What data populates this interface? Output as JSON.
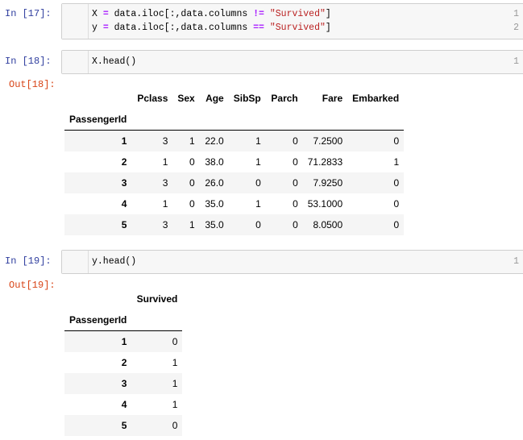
{
  "cells": [
    {
      "prompt": "In [17]:",
      "lines": [
        {
          "num": "1",
          "a": "X ",
          "op": "!=",
          "pre": " data.iloc[:,data.columns ",
          "str": "\"Survived\"",
          "post": "]"
        },
        {
          "num": "2",
          "a": "y ",
          "op": "==",
          "pre": " data.iloc[:,data.columns ",
          "str": "\"Survived\"",
          "post": "]"
        }
      ]
    },
    {
      "prompt": "In [18]:",
      "line": {
        "num": "1",
        "code": "X.head()"
      },
      "out": "Out[18]:"
    },
    {
      "prompt": "In [19]:",
      "line": {
        "num": "1",
        "code": "y.head()"
      },
      "out": "Out[19]:"
    }
  ],
  "eq": "=",
  "table_x": {
    "columns": [
      "Pclass",
      "Sex",
      "Age",
      "SibSp",
      "Parch",
      "Fare",
      "Embarked"
    ],
    "index_name": "PassengerId",
    "rows": [
      [
        "1",
        "3",
        "1",
        "22.0",
        "1",
        "0",
        "7.2500",
        "0"
      ],
      [
        "2",
        "1",
        "0",
        "38.0",
        "1",
        "0",
        "71.2833",
        "1"
      ],
      [
        "3",
        "3",
        "0",
        "26.0",
        "0",
        "0",
        "7.9250",
        "0"
      ],
      [
        "4",
        "1",
        "0",
        "35.0",
        "1",
        "0",
        "53.1000",
        "0"
      ],
      [
        "5",
        "3",
        "1",
        "35.0",
        "0",
        "0",
        "8.0500",
        "0"
      ]
    ]
  },
  "table_y": {
    "columns": [
      "Survived"
    ],
    "index_name": "PassengerId",
    "rows": [
      [
        "1",
        "0"
      ],
      [
        "2",
        "1"
      ],
      [
        "3",
        "1"
      ],
      [
        "4",
        "1"
      ],
      [
        "5",
        "0"
      ]
    ]
  }
}
